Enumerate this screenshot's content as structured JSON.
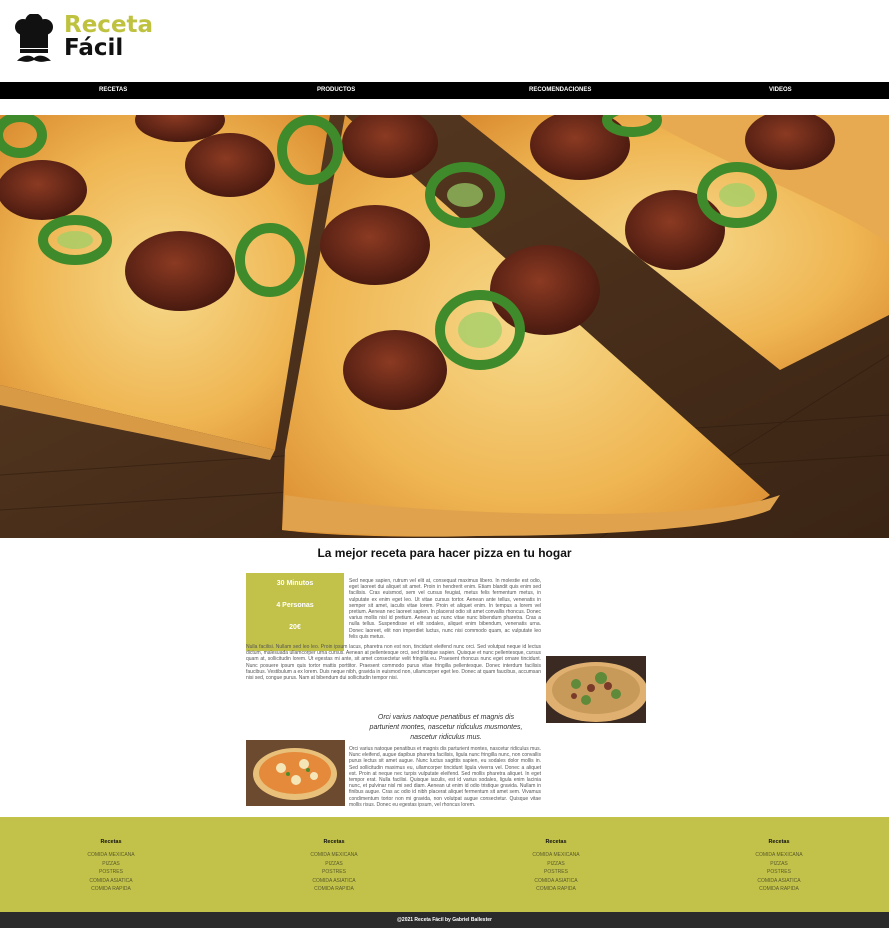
{
  "brand": {
    "line1": "Receta",
    "line2": "Fácil",
    "accent_color": "#bfc23f",
    "icon": "chef-hat-mustache-icon"
  },
  "nav": {
    "items": [
      {
        "label": "RECETAS"
      },
      {
        "label": "PRODUCTOS"
      },
      {
        "label": "RECOMENDACIONES"
      },
      {
        "label": "VIDEOS"
      }
    ]
  },
  "hero": {
    "image": "pizza-hero-image"
  },
  "main": {
    "title": "La mejor receta para hacer pizza en tu hogar",
    "info": {
      "time": "30 Minutos",
      "servings": "4 Personas",
      "price": "20€"
    },
    "paragraph1": "Sed neque sapien, rutrum vel elit at, consequat maximus libero. In molestie est odio, eget laoreet dui aliquet sit amet. Proin in hendrerit enim. Etiam blandit quis enim sed facilisis. Cras euismod, sem vel cursus feugiat, metus felis fermentum metus, in vulputate ex enim eget leo. Ut vitae cursus tortor. Aenean ante tellus, venenatis in semper sit amet, iaculis vitae lorem. Proin et aliquet enim. In tempus a lorem vel pretium. Aenean nec laoreet sapien. In placerat odio sit amet convallis rhoncus. Donec varius mollis nisl id pretium. Aenean ac nunc vitae nunc bibendum pharetra. Cras a nulla tellus. Suspendisse et elit sodales, aliquet enim bibendum, venenatis urna. Donec laoreet, elit non imperdiet luctus, nunc nisi commodo quam, ac vulputate leo felis quis metus.",
    "paragraph2": "Nulla facilisi. Nullam sed leo leo. Proin ipsum lacus, pharetra non est non, tincidunt eleifend nunc orci. Sed volutpat neque id lectus dictum, malesuada ullamcorper urna cursus. Aenean at pellentesque orci, sed tristique sapien. Quisque et nunc pellentesque, cursus quam at, sollicitudin lorem. Ut egestas mi ante, sit amet consectetur velit fringilla eu. Praesent rhoncus nunc eget ornare tincidunt. Nunc posuere ipsum quis tortor mattis porttitor. Praesent commodo purus vitae fringilla pellentesque. Donec interdum facilisis faucibus. Vestibulum a ex lorem. Duis neque nibh, gravida in euismod non, ullamcorper eget leo. Donec at quam faucibus, accumsan nisi sed, congue purus. Nam at bibendum dui sollicitudin tempor nisi.",
    "quote": "Orci varius natoque penatibus et magnis dis parturient montes, nascetur ridiculus musmontes, nascetur ridiculus mus.",
    "paragraph3": "Orci varius natoque penatibus et magnis dis parturient montes, nascetur ridiculus mus. Nunc eleifend, augue dapibus pharetra facilisis, ligula nunc fringilla nunc, non convallis purus lectus sit amet augue. Nunc luctus sagittis sapien, eu sodales dolor mollis in. Sed sollicitudin maximus eu, ullamcorper tincidunt ligula viverra vel. Donec a aliquet est. Proin at neque nec turpis vulputate eleifend. Sed mollis pharetra aliquet. In eget tempor erat. Nulla facilisi. Quisque iaculis, est id varius sodales, ligula enim lacinia nunc, et pulvinar nisl mi sed diam. Aenean ut enim id odio tristique gravida. Nullam in finibus augue. Cras ac odio id nibh placerat aliquet fermentum sit amet sem. Vivamus condimentum tortor non mi gravida, non volutpat augue consectetur. Quisque vitae mollis risus. Donec eu egestas ipsum, vel rhoncus lorem."
  },
  "footer": {
    "columns": [
      {
        "heading": "Recetas",
        "links": [
          "COMIDA MEXICANA",
          "PIZZAS",
          "POSTRES",
          "COMIDA ASIATICA",
          "COMIDA RAPIDA"
        ]
      },
      {
        "heading": "Recetas",
        "links": [
          "COMIDA MEXICANA",
          "PIZZAS",
          "POSTRES",
          "COMIDA ASIATICA",
          "COMIDA RAPIDA"
        ]
      },
      {
        "heading": "Recetas",
        "links": [
          "COMIDA MEXICANA",
          "PIZZAS",
          "POSTRES",
          "COMIDA ASIATICA",
          "COMIDA RAPIDA"
        ]
      },
      {
        "heading": "Recetas",
        "links": [
          "COMIDA MEXICANA",
          "PIZZAS",
          "POSTRES",
          "COMIDA ASIATICA",
          "COMIDA RAPIDA"
        ]
      }
    ],
    "copyright": "@2021 Receta Fácil by Gabriel Ballester",
    "bg_color": "#c2c24a"
  }
}
